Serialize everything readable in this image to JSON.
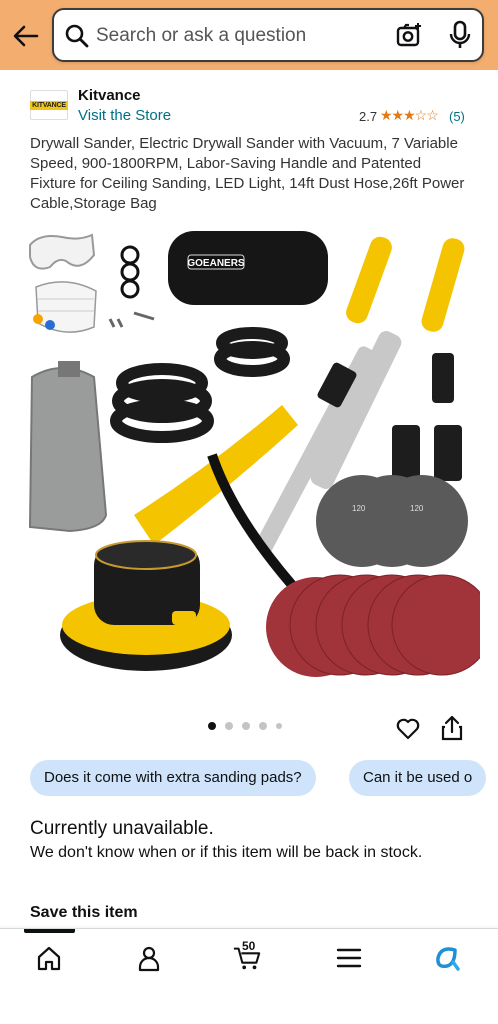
{
  "header": {
    "search_placeholder": "Search or ask a question",
    "icons": [
      "back-arrow-icon",
      "search-icon",
      "camera-icon",
      "microphone-icon"
    ],
    "background_color": "#f3ae6f"
  },
  "seller": {
    "logo_text": "KITVANCE",
    "brand_name": "Kitvance",
    "store_link": "Visit the Store"
  },
  "rating": {
    "value": "2.7",
    "stars": "★★★☆☆",
    "count": "(5)"
  },
  "product": {
    "title": "Drywall Sander, Electric Drywall Sander with Vacuum, 7 Variable Speed, 900-1800RPM, Labor-Saving Handle and Patented Fixture for Ceiling Sanding, LED Light, 14ft Dust Hose,26ft Power Cable,Storage Bag",
    "image_alt": "Drywall sander kit with bag, hoses, sanding pads and accessories",
    "bag_logo": "GOEANERS",
    "image_count": 5,
    "active_image": 1
  },
  "questions": [
    {
      "label": "Does it come with extra sanding pads?"
    },
    {
      "label": "Can it be used o"
    }
  ],
  "availability": {
    "heading": "Currently unavailable.",
    "message": "We don't know when or if this item will be back in stock."
  },
  "save_item": {
    "heading": "Save this item"
  },
  "bottom_nav": {
    "items": [
      "home-icon",
      "account-icon",
      "cart-icon",
      "menu-icon",
      "rufus-icon"
    ],
    "cart_count": "50",
    "active_item": "home"
  },
  "colors": {
    "link": "#007185",
    "star": "#e47911",
    "chip": "#cfe3fb",
    "accent_yellow": "#f5c400"
  }
}
